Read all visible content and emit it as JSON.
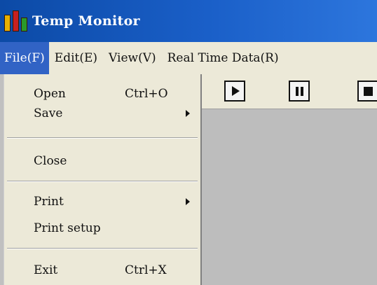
{
  "window": {
    "title": "Temp Monitor",
    "icon": "bar-chart-app-icon",
    "colors": {
      "titlebar": "#1a5fc8",
      "menubar": "#ece9d8",
      "menu_highlight": "#3163c5",
      "client_area": "#bdbdbd"
    }
  },
  "menubar": {
    "items": [
      {
        "label": "File(F)"
      },
      {
        "label": "Edit(E)"
      },
      {
        "label": "View(V)"
      },
      {
        "label": "Real Time Data(R)"
      }
    ],
    "active": "File(F)"
  },
  "toolbar": {
    "buttons": [
      {
        "icon": "play-icon"
      },
      {
        "icon": "pause-icon"
      },
      {
        "icon": "stop-icon"
      }
    ]
  },
  "file_menu": {
    "items": [
      {
        "label": "Open",
        "shortcut": "Ctrl+O"
      },
      {
        "label": "Save",
        "submenu": true
      },
      {
        "label": "Close"
      },
      {
        "label": "Print",
        "submenu": true
      },
      {
        "label": "Print setup"
      },
      {
        "label": "Exit",
        "shortcut": "Ctrl+X"
      }
    ]
  }
}
